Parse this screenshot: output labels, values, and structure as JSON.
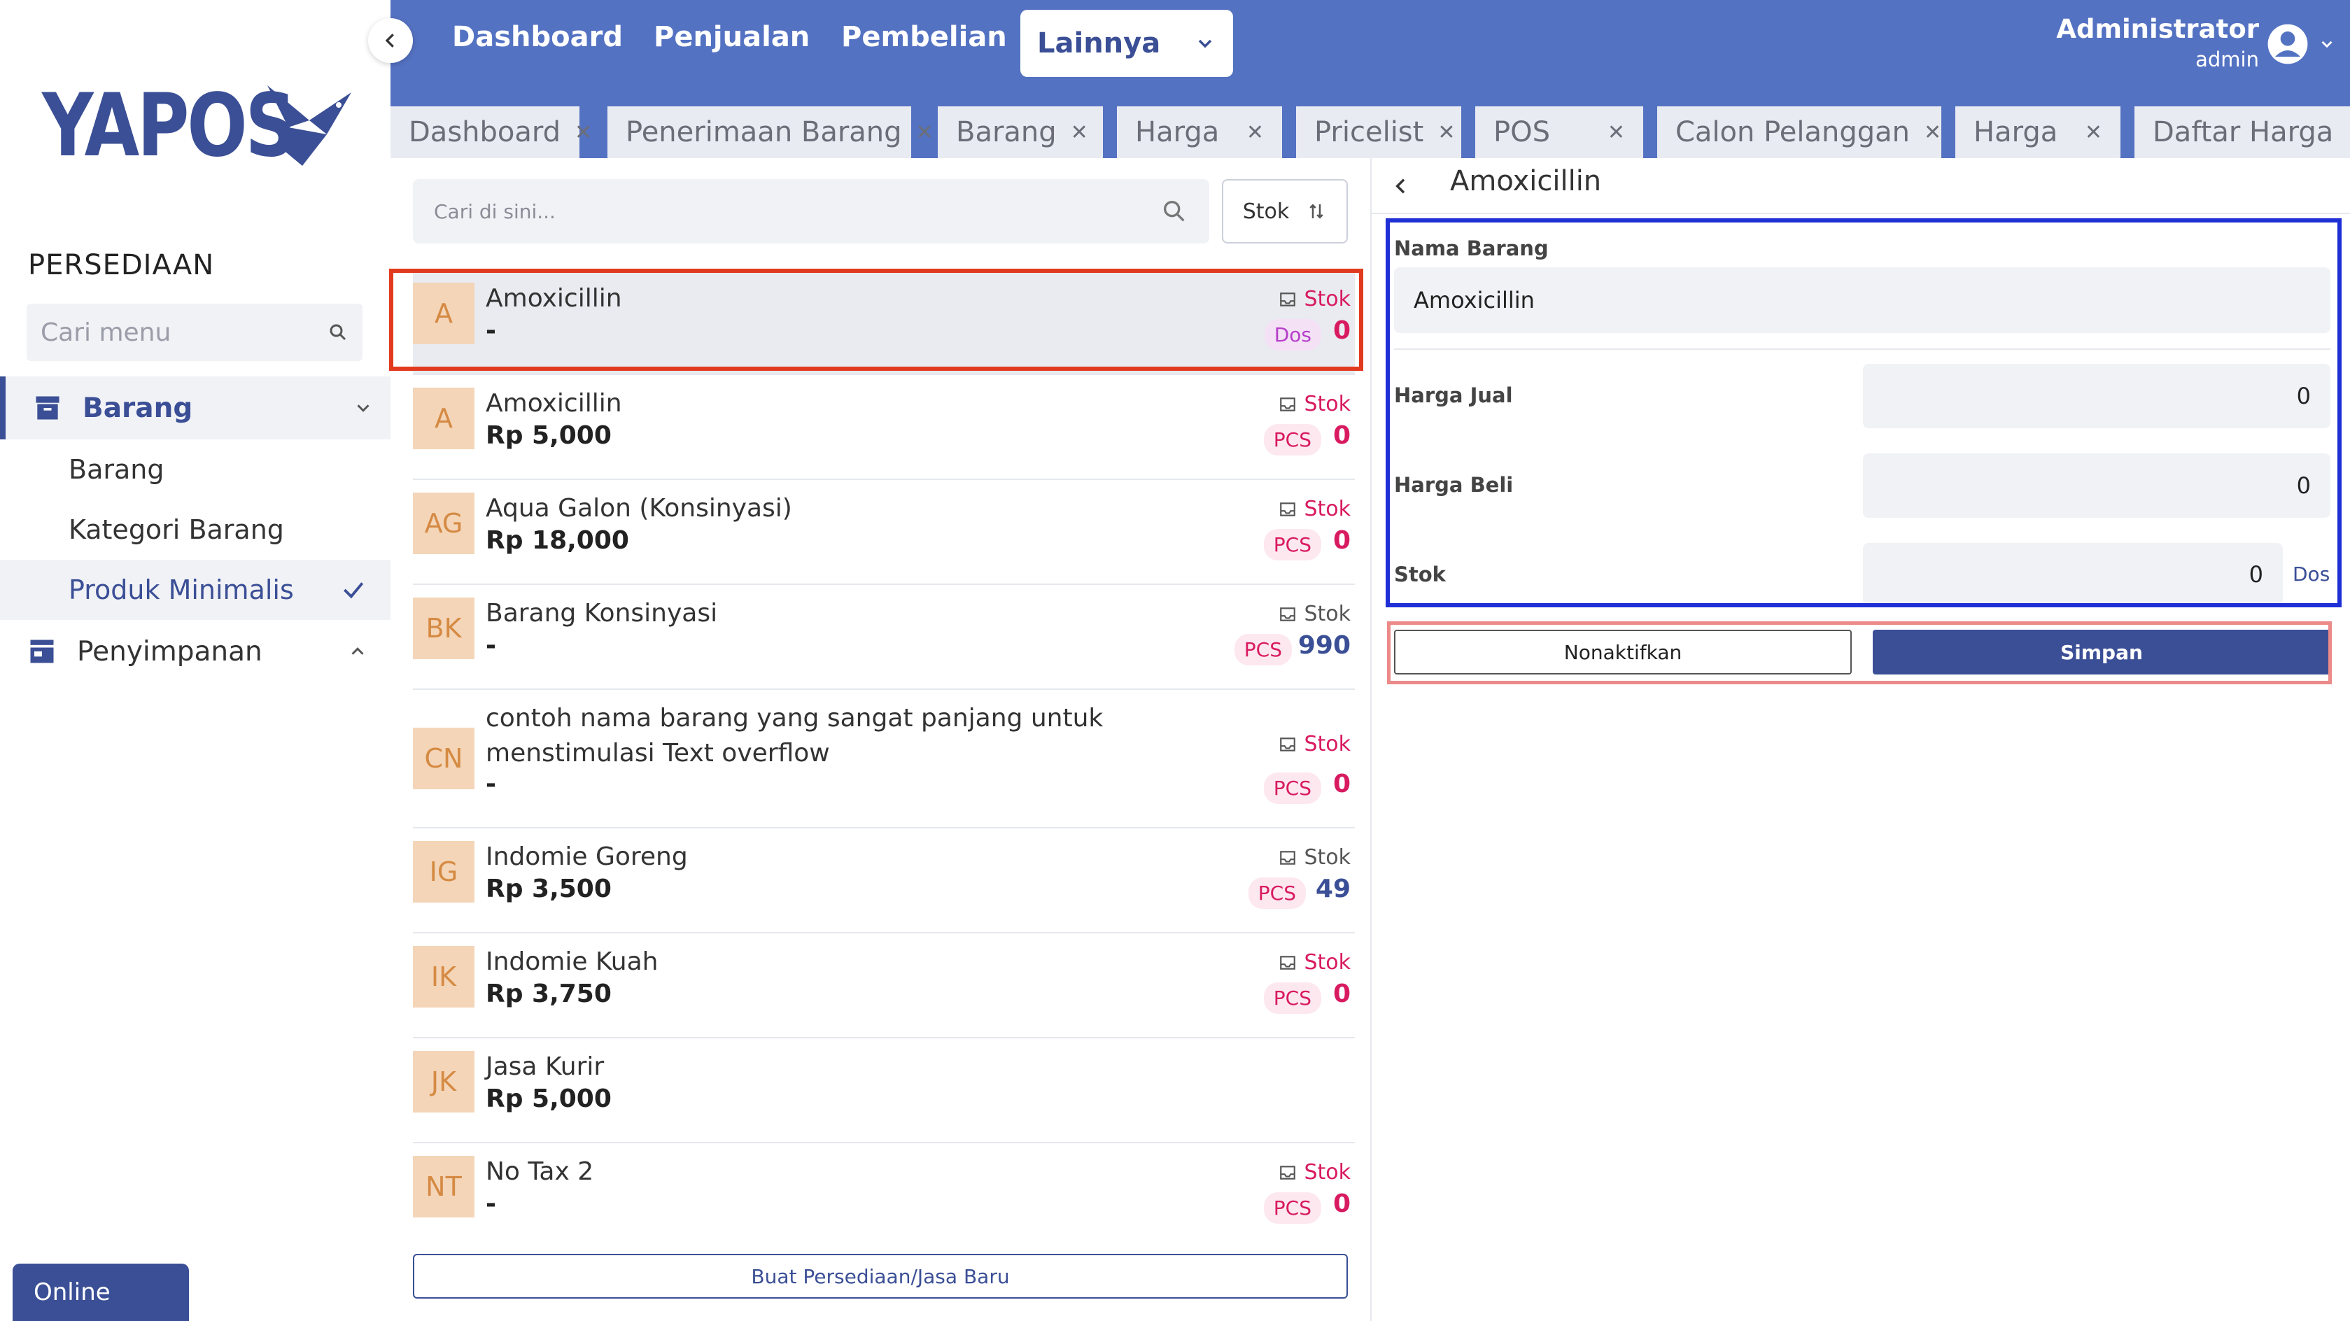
{
  "sidebar": {
    "logo_text": "YAPOS",
    "section_title": "PERSEDIAAN",
    "search_placeholder": "Cari menu",
    "groups": [
      {
        "label": "Barang",
        "icon": "archive-icon",
        "expanded": true
      },
      {
        "label": "Penyimpanan",
        "icon": "store-icon",
        "expanded": false
      }
    ],
    "sub_items": [
      {
        "label": "Barang"
      },
      {
        "label": "Kategori Barang"
      },
      {
        "label": "Produk Minimalis",
        "selected": true
      }
    ],
    "status": "Online"
  },
  "topnav": {
    "items": [
      "Dashboard",
      "Penjualan",
      "Pembelian"
    ],
    "dropdown_label": "Lainnya",
    "user_name": "Administrator",
    "user_role": "admin"
  },
  "tabs": [
    {
      "label": "Dashboard"
    },
    {
      "label": "Penerimaan Barang"
    },
    {
      "label": "Barang"
    },
    {
      "label": "Harga"
    },
    {
      "label": "Pricelist"
    },
    {
      "label": "POS"
    },
    {
      "label": "Calon Pelanggan"
    },
    {
      "label": "Harga"
    },
    {
      "label": "Daftar Harga"
    }
  ],
  "list": {
    "search_placeholder": "Cari di sini...",
    "sort_label": "Stok",
    "stock_label": "Stok",
    "items": [
      {
        "initials": "A",
        "name": "Amoxicillin",
        "price": "-",
        "unit": "Dos",
        "qty": "0",
        "selected": true
      },
      {
        "initials": "A",
        "name": "Amoxicillin",
        "price": "Rp 5,000",
        "unit": "PCS",
        "qty": "0"
      },
      {
        "initials": "AG",
        "name": "Aqua Galon (Konsinyasi)",
        "price": "Rp 18,000",
        "unit": "PCS",
        "qty": "0"
      },
      {
        "initials": "BK",
        "name": "Barang Konsinyasi",
        "price": "-",
        "unit": "PCS",
        "qty": "990"
      },
      {
        "initials": "CN",
        "name": "contoh nama barang yang sangat panjang untuk menstimulasi Text overflow",
        "price": "-",
        "unit": "PCS",
        "qty": "0"
      },
      {
        "initials": "IG",
        "name": "Indomie Goreng",
        "price": "Rp 3,500",
        "unit": "PCS",
        "qty": "49"
      },
      {
        "initials": "IK",
        "name": "Indomie Kuah",
        "price": "Rp 3,750",
        "unit": "PCS",
        "qty": "0"
      },
      {
        "initials": "JK",
        "name": "Jasa Kurir",
        "price": "Rp 5,000"
      },
      {
        "initials": "NT",
        "name": "No Tax 2",
        "price": "-",
        "unit": "PCS",
        "qty": "0"
      }
    ],
    "create_button": "Buat Persediaan/Jasa Baru"
  },
  "detail": {
    "title": "Amoxicillin",
    "nama_barang_label": "Nama Barang",
    "nama_barang_value": "Amoxicillin",
    "harga_jual_label": "Harga Jual",
    "harga_jual_value": "0",
    "harga_beli_label": "Harga Beli",
    "harga_beli_value": "0",
    "stok_label": "Stok",
    "stok_value": "0",
    "stok_unit": "Dos",
    "deactivate_button": "Nonaktifkan",
    "save_button": "Simpan"
  },
  "colors": {
    "brand": "#3b4f96",
    "topbar": "#5472c2",
    "accent_red": "#d81b60"
  }
}
